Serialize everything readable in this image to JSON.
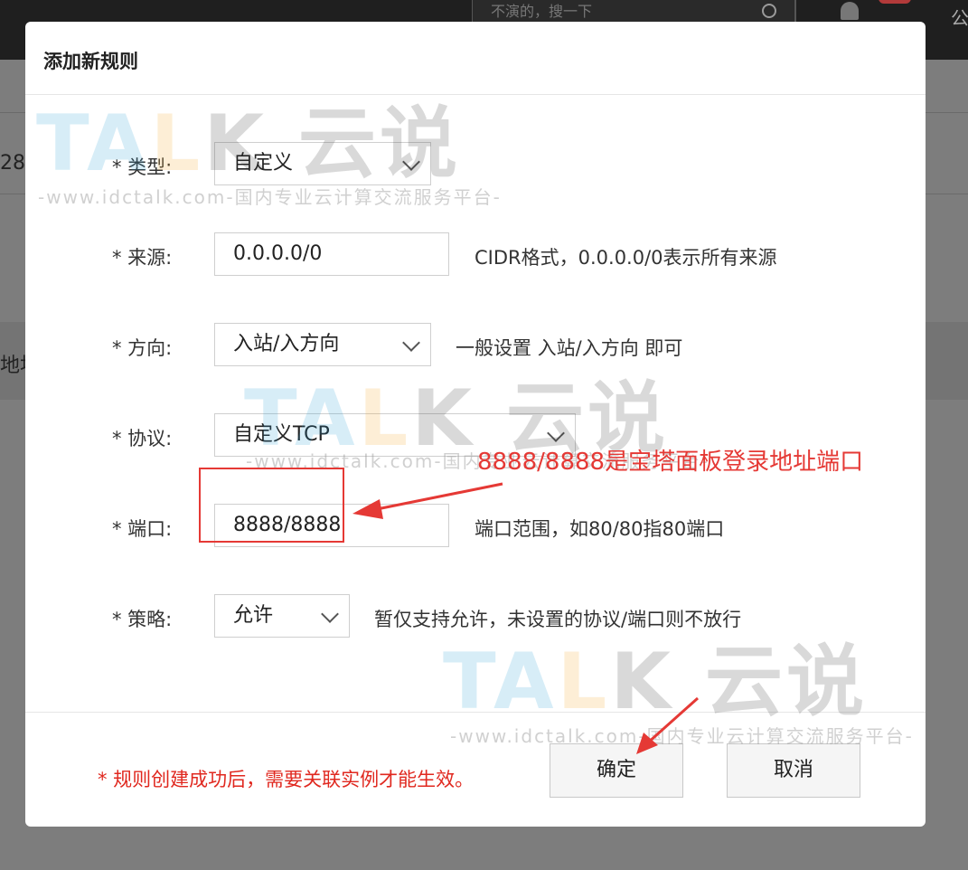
{
  "background": {
    "search_placeholder": "不演的，搜一下",
    "top_char": "公",
    "left_text_1": "28",
    "left_text_2": "地址"
  },
  "modal": {
    "title": "添加新规则",
    "fields": {
      "type": {
        "label": "*  类型:",
        "value": "自定义"
      },
      "source": {
        "label": "*  来源:",
        "value": "0.0.0.0/0",
        "hint": "CIDR格式，0.0.0.0/0表示所有来源"
      },
      "direction": {
        "label": "*  方向:",
        "value": "入站/入方向",
        "hint": "一般设置 入站/入方向 即可"
      },
      "protocol": {
        "label": "*  协议:",
        "value": "自定义TCP"
      },
      "port": {
        "label": "*  端口:",
        "value": "8888/8888",
        "hint": "端口范围，如80/80指80端口"
      },
      "policy": {
        "label": "*  策略:",
        "value": "允许",
        "hint": "暂仅支持允许，未设置的协议/端口则不放行"
      }
    },
    "note": "*  规则创建成功后，需要关联实例才能生效。",
    "confirm_label": "确定",
    "cancel_label": "取消"
  },
  "annotation": {
    "text": "8888/8888是宝塔面板登录地址端口",
    "color": "#e53935"
  },
  "watermark": {
    "logo_t": "TA",
    "logo_l": "L",
    "logo_k": "K 云说",
    "url": "-www.idctalk.com-国内专业云计算交流服务平台-"
  },
  "colors": {
    "accent_red": "#e0281f",
    "overlay": "#8a8a8a"
  }
}
